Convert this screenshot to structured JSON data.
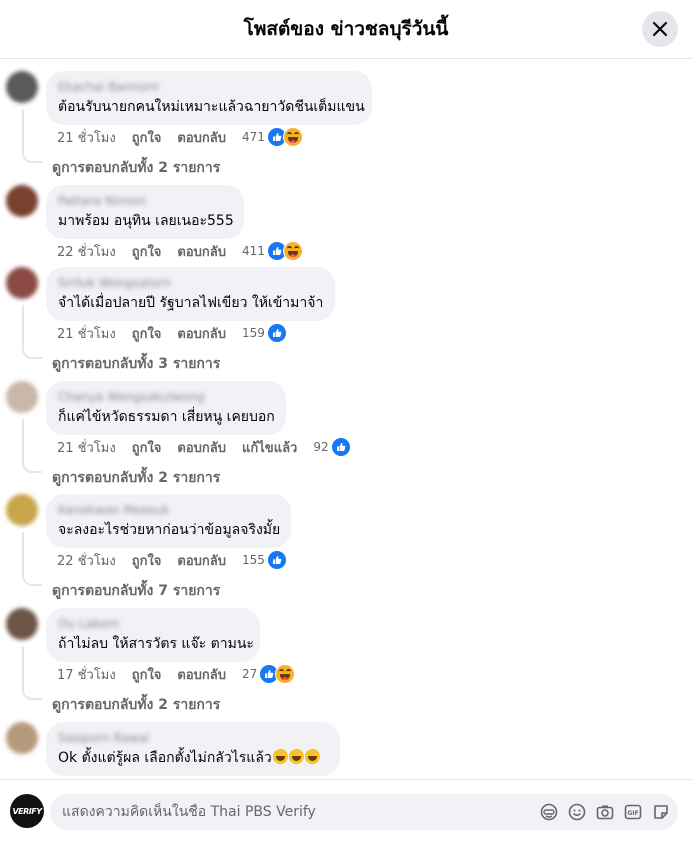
{
  "header": {
    "title": "โพสต์ของ ข่าวชลบุรีวันนี้",
    "close_icon": "close-icon"
  },
  "comments": [
    {
      "author": "Ekachai Bannorn",
      "text": "ต้อนรับนายกคนใหม่เหมาะแล้วฉายาวัดชีนเต็มแขน",
      "time": "21 ชั่วโมง",
      "like_label": "ถูกใจ",
      "reply_label": "ตอบกลับ",
      "edited_label": "",
      "reaction_count": "471",
      "reactions": [
        "like",
        "haha"
      ],
      "view_replies": "ดูการตอบกลับทั้ง 2 รายการ",
      "avatar_color": "#5a5a5a"
    },
    {
      "author": "Pattara Nimsin",
      "text": "มาพร้อม อนุทิน เลยเนอะ555",
      "time": "22 ชั่วโมง",
      "like_label": "ถูกใจ",
      "reply_label": "ตอบกลับ",
      "edited_label": "",
      "reaction_count": "411",
      "reactions": [
        "like",
        "haha"
      ],
      "view_replies": "",
      "avatar_color": "#7a4030"
    },
    {
      "author": "Siriluk Wongsatorn",
      "text": "จำได้เมื่อปลายปี รัฐบาลไฟเขียว ให้เข้ามาจ้า",
      "time": "21 ชั่วโมง",
      "like_label": "ถูกใจ",
      "reply_label": "ตอบกลับ",
      "edited_label": "",
      "reaction_count": "159",
      "reactions": [
        "like"
      ],
      "view_replies": "ดูการตอบกลับทั้ง 3 รายการ",
      "avatar_color": "#8b4a45"
    },
    {
      "author": "Chanya Wongsakulwong",
      "text": "ก็แค่ไข้หวัดธรรมดา เสี่ยหนู เคยบอก",
      "time": "21 ชั่วโมง",
      "like_label": "ถูกใจ",
      "reply_label": "ตอบกลับ",
      "edited_label": "แก้ไขแล้ว",
      "reaction_count": "92",
      "reactions": [
        "like"
      ],
      "view_replies": "ดูการตอบกลับทั้ง 2 รายการ",
      "avatar_color": "#c9b7a8"
    },
    {
      "author": "Kanokwan Meesuk",
      "text": "จะลงอะไรช่วยหาก่อนว่าข้อมูลจริงมั้ย",
      "time": "22 ชั่วโมง",
      "like_label": "ถูกใจ",
      "reply_label": "ตอบกลับ",
      "edited_label": "",
      "reaction_count": "155",
      "reactions": [
        "like"
      ],
      "view_replies": "ดูการตอบกลับทั้ง 7 รายการ",
      "avatar_color": "#c7a64a"
    },
    {
      "author": "Ou Lakorn",
      "text": "ถ้าไม่ลบ ให้สารวัตร แจ๊ะ ตามนะ",
      "time": "17 ชั่วโมง",
      "like_label": "ถูกใจ",
      "reply_label": "ตอบกลับ",
      "edited_label": "",
      "reaction_count": "27",
      "reactions": [
        "like",
        "haha"
      ],
      "view_replies": "ดูการตอบกลับทั้ง 2 รายการ",
      "avatar_color": "#6d5548"
    },
    {
      "author": "Sasiporn Rawai",
      "text": "Ok ตั้งแต่รู้ผล เลือกตั้งไม่กลัวไรแล้ว",
      "time": "",
      "like_label": "",
      "reply_label": "",
      "edited_label": "",
      "reaction_count": "",
      "reactions": [],
      "view_replies": "",
      "avatar_color": "#b49a7a",
      "trailing_emoji": 3
    }
  ],
  "composer": {
    "avatar_text": "VERIFY",
    "placeholder": "แสดงความคิดเห็นในชื่อ Thai PBS Verify",
    "tools": [
      "avatar-sticker-icon",
      "emoji-icon",
      "camera-icon",
      "gif-icon",
      "sticker-icon"
    ]
  },
  "colors": {
    "like": "#1877f2",
    "haha": "#f7b125",
    "bubble": "#f0f2f5",
    "muted_text": "#65676b"
  }
}
